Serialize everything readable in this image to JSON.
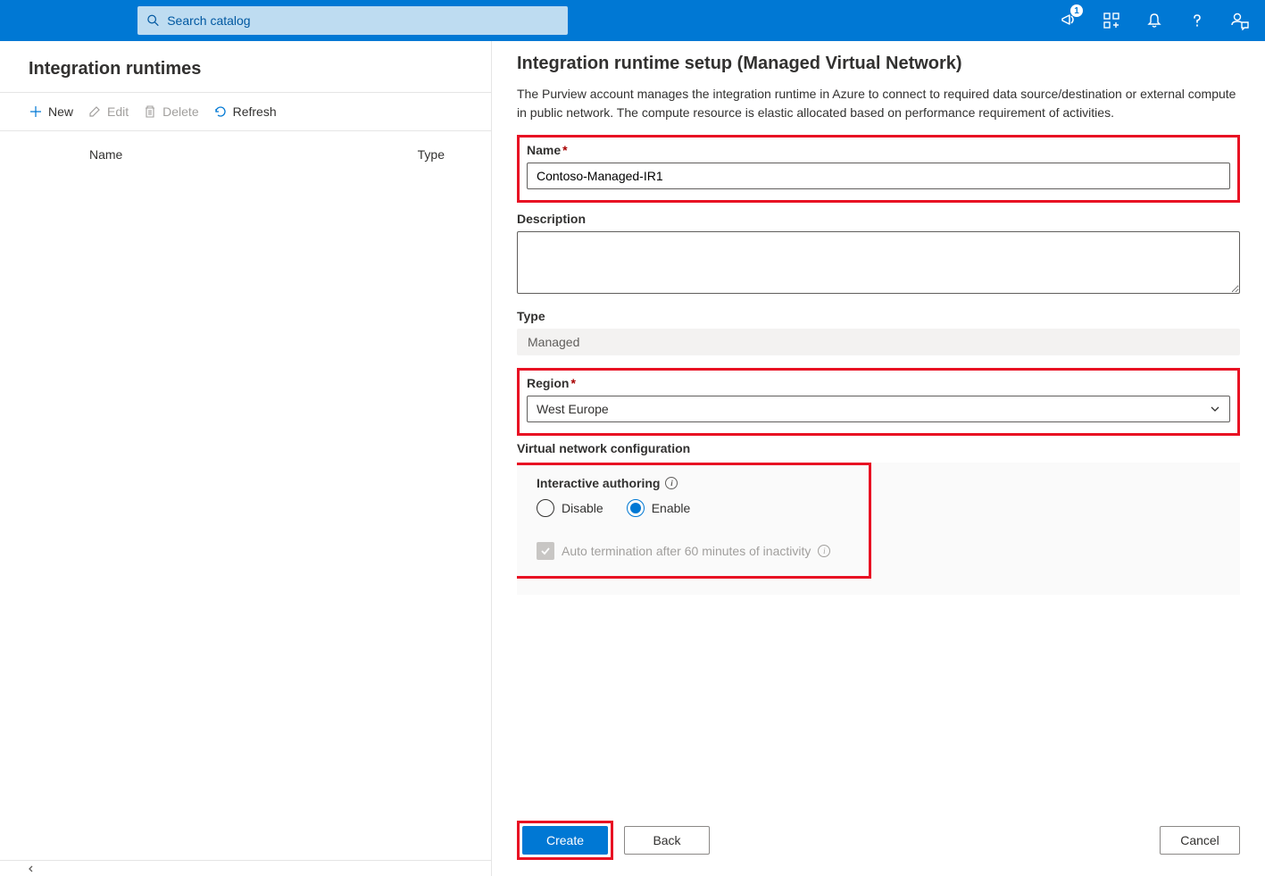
{
  "topbar": {
    "search_placeholder": "Search catalog",
    "notification_count": "1"
  },
  "left": {
    "title": "Integration runtimes",
    "toolbar": {
      "new": "New",
      "edit": "Edit",
      "delete": "Delete",
      "refresh": "Refresh"
    },
    "columns": {
      "name": "Name",
      "type": "Type"
    }
  },
  "panel": {
    "title": "Integration runtime setup (Managed Virtual Network)",
    "description": "The Purview account manages the integration runtime in Azure to connect to required data source/destination or external compute in public network. The compute resource is elastic allocated based on performance requirement of activities.",
    "name_label": "Name",
    "name_value": "Contoso-Managed-IR1",
    "description_label": "Description",
    "description_value": "",
    "type_label": "Type",
    "type_value": "Managed",
    "region_label": "Region",
    "region_value": "West Europe",
    "vnet_label": "Virtual network configuration",
    "interactive_label": "Interactive authoring",
    "radio_disable": "Disable",
    "radio_enable": "Enable",
    "auto_term": "Auto termination after 60 minutes of inactivity",
    "buttons": {
      "create": "Create",
      "back": "Back",
      "cancel": "Cancel"
    }
  }
}
